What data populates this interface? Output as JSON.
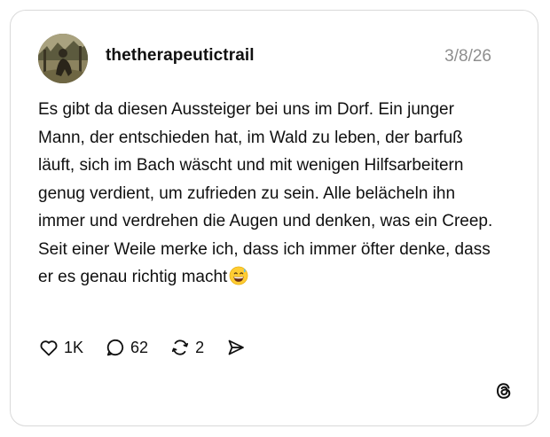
{
  "post": {
    "username": "thetherapeutictrail",
    "date": "3/8/26",
    "text": "Es gibt da diesen Aussteiger bei uns im Dorf. Ein junger Mann, der entschieden hat, im Wald zu leben, der barfuß läuft, sich im Bach wäscht und mit wenigen Hilfsarbeitern genug verdient, um zufrieden zu sein. Alle belächeln ihn immer und verdrehen die Augen und denken, was ein Creep. Seit einer Weile merke ich, dass ich immer öfter denke, dass er es genau richtig macht",
    "emoji": "grinning-face-with-sweat",
    "likes": "1K",
    "replies": "62",
    "reposts": "2"
  },
  "icons": {
    "like": "heart-icon",
    "reply": "speech-bubble-icon",
    "repost": "repost-icon",
    "share": "send-icon",
    "brand": "threads-logo-icon"
  }
}
